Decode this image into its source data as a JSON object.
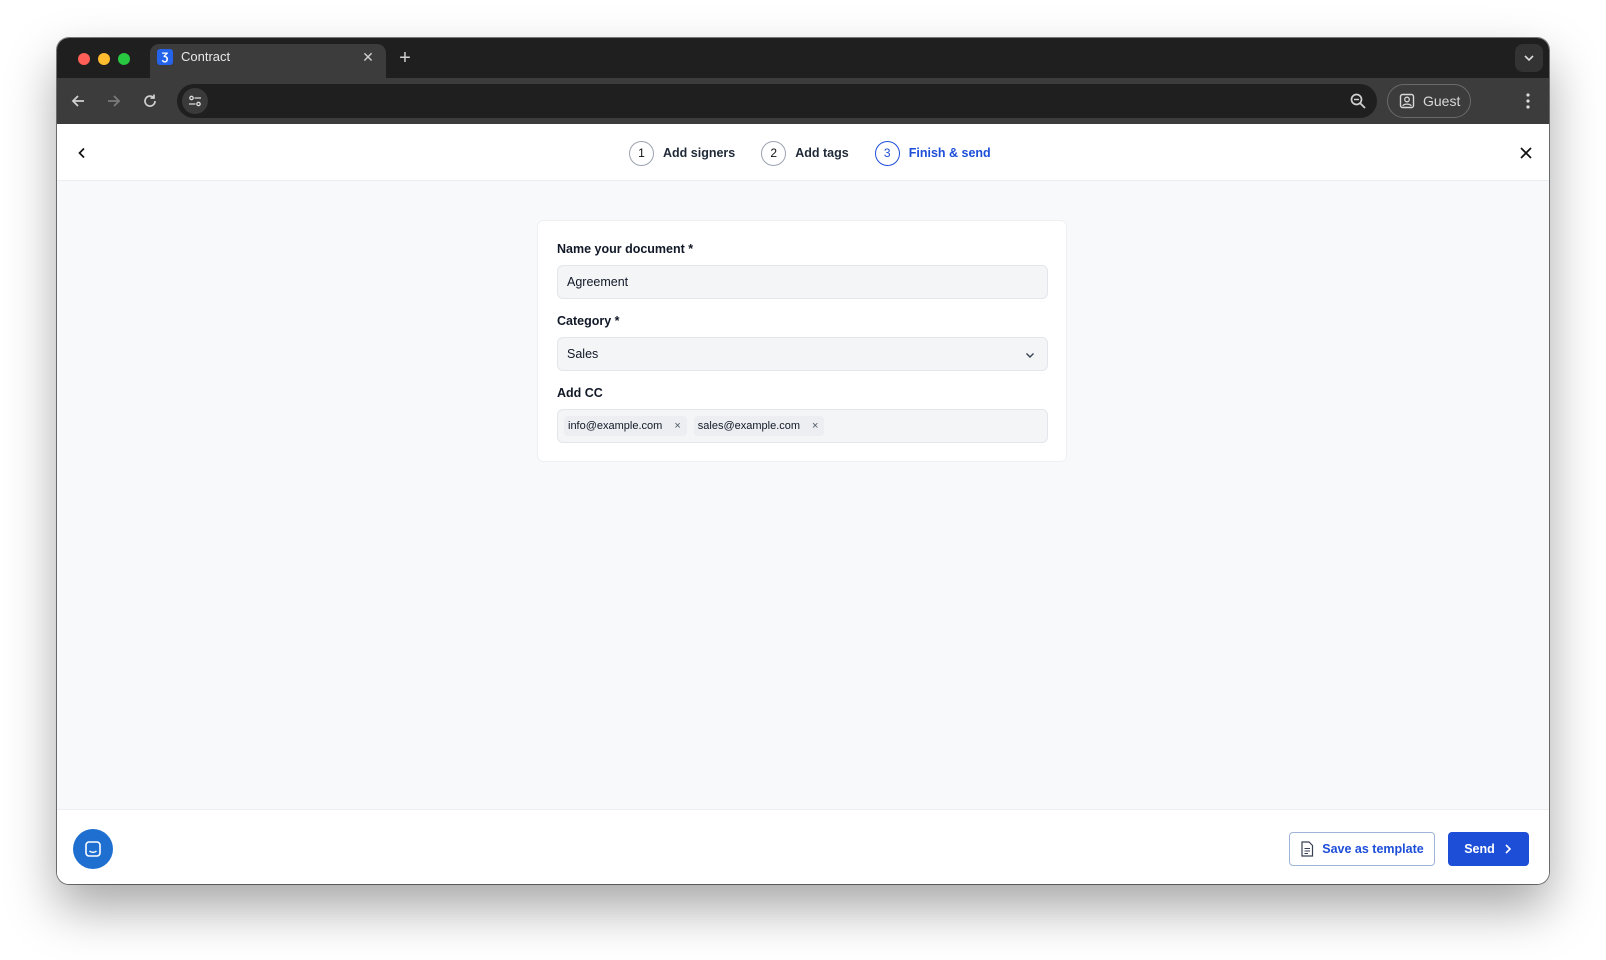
{
  "browser": {
    "tab_title": "Contract",
    "favicon_glyph": "Ʒ",
    "close_tab_glyph": "✕",
    "new_tab_glyph": "+",
    "tab_menu_glyph": "⌄",
    "address_value": "",
    "profile_label": "Guest"
  },
  "stepper": {
    "steps": [
      {
        "number": "1",
        "label": "Add signers",
        "state": "done"
      },
      {
        "number": "2",
        "label": "Add tags",
        "state": "done"
      },
      {
        "number": "3",
        "label": "Finish & send",
        "state": "active"
      }
    ]
  },
  "form": {
    "name_label": "Name your document",
    "name_required_mark": "*",
    "name_value": "Agreement",
    "category_label": "Category",
    "category_required_mark": "*",
    "category_value": "Sales",
    "cc_label": "Add CC",
    "cc_chips": [
      {
        "email": "info@example.com",
        "remove_glyph": "×"
      },
      {
        "email": "sales@example.com",
        "remove_glyph": "×"
      }
    ]
  },
  "footer": {
    "save_template_label": "Save as template",
    "send_label": "Send"
  },
  "colors": {
    "accent": "#1d4ed8",
    "chat_bubble": "#1e6fd0",
    "titlebar": "#1f1f1f",
    "toolbar": "#3c3c3c"
  },
  "icons": [
    "back-arrow-icon",
    "forward-arrow-icon",
    "reload-icon",
    "site-settings-icon",
    "zoom-icon",
    "profile-icon",
    "kebab-menu-icon",
    "chevron-left-icon",
    "close-icon",
    "chevron-down-icon",
    "document-icon",
    "chevron-right-icon",
    "chat-icon"
  ]
}
